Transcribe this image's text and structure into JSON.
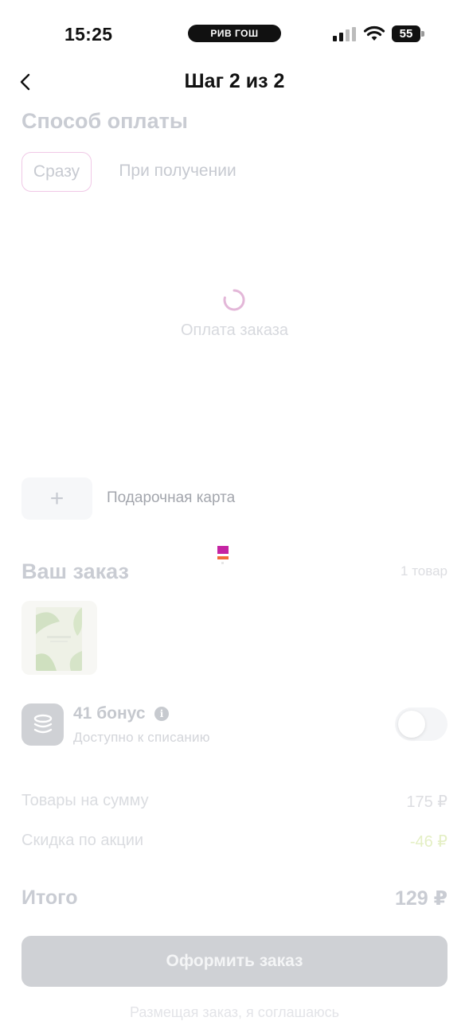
{
  "status_bar": {
    "time": "15:25",
    "carrier_pill": "РИВ ГОШ",
    "battery": "55"
  },
  "header": {
    "title": "Шаг 2 из 2"
  },
  "payment": {
    "section_title": "Способ оплаты",
    "tabs": [
      {
        "label": "Сразу",
        "active": true
      },
      {
        "label": "При получении",
        "active": false
      }
    ],
    "loading_text": "Оплата заказа"
  },
  "gift_card": {
    "label": "Подарочная карта"
  },
  "order": {
    "title": "Ваш заказ",
    "count": "1 товар"
  },
  "bonus": {
    "title": "41 бонус",
    "subtitle": "Доступно к списанию",
    "enabled": false
  },
  "summary": {
    "rows": [
      {
        "label": "Товары на сумму",
        "value": "175 ₽"
      },
      {
        "label": "Скидка по акции",
        "value": "-46 ₽"
      }
    ],
    "total_label": "Итого",
    "total_value": "129 ₽"
  },
  "submit_label": "Оформить заказ",
  "terms_text": "Размещая заказ, я соглашаюсь",
  "colors": {
    "accent": "#c524a3",
    "disabled_button": "#cfd1d5"
  }
}
